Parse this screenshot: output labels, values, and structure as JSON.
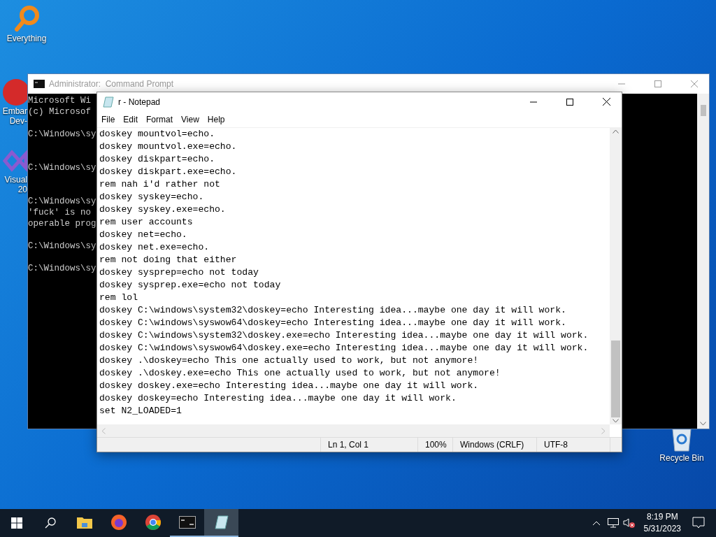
{
  "desktop_icons": [
    {
      "kind": "magnifier",
      "lines": [
        "Everything"
      ]
    },
    {
      "kind": "badge",
      "lines": [
        "Embar",
        "Dev-"
      ]
    },
    {
      "kind": "ribbon",
      "lines": [
        "Visual",
        "20"
      ]
    }
  ],
  "cmd": {
    "title": "Administrator:  Command Prompt",
    "blocks": [
      {
        "lines": [
          "Microsoft Wi",
          "(c) Microsof"
        ]
      },
      {
        "lines": [
          "C:\\Windows\\sy"
        ]
      },
      {
        "lines": [
          "C:\\Windows\\sy"
        ]
      },
      {
        "lines": [
          "C:\\Windows\\sy",
          "'fuck' is no",
          "operable prog"
        ]
      },
      {
        "lines": [
          "C:\\Windows\\sy"
        ]
      },
      {
        "lines": [
          "C:\\Windows\\sy"
        ]
      }
    ]
  },
  "notepad": {
    "title": "r - Notepad",
    "menu": [
      "File",
      "Edit",
      "Format",
      "View",
      "Help"
    ],
    "lines": [
      "doskey mountvol=echo.",
      "doskey mountvol.exe=echo.",
      "doskey diskpart=echo.",
      "doskey diskpart.exe=echo.",
      "rem nah i'd rather not",
      "doskey syskey=echo.",
      "doskey syskey.exe=echo.",
      "rem user accounts",
      "doskey net=echo.",
      "doskey net.exe=echo.",
      "rem not doing that either",
      "doskey sysprep=echo not today",
      "doskey sysprep.exe=echo not today",
      "rem lol",
      "doskey C:\\windows\\system32\\doskey=echo Interesting idea...maybe one day it will work.",
      "doskey C:\\windows\\syswow64\\doskey=echo Interesting idea...maybe one day it will work.",
      "doskey C:\\windows\\system32\\doskey.exe=echo Interesting idea...maybe one day it will work.",
      "doskey C:\\windows\\syswow64\\doskey.exe=echo Interesting idea...maybe one day it will work.",
      "doskey .\\doskey=echo This one actually used to work, but not anymore!",
      "doskey .\\doskey.exe=echo This one actually used to work, but not anymore!",
      "doskey doskey.exe=echo Interesting idea...maybe one day it will work.",
      "doskey doskey=echo Interesting idea...maybe one day it will work.",
      "set N2_LOADED=1"
    ],
    "status": [
      "Ln 1, Col 1",
      "100%",
      "Windows (CRLF)",
      "UTF-8"
    ]
  },
  "recycle_bin": {
    "label": "Recycle Bin"
  },
  "taskbar": {
    "apps": [
      {
        "kind": "folder",
        "selected": false,
        "running": false
      },
      {
        "kind": "firefox",
        "selected": false,
        "running": false
      },
      {
        "kind": "chrome",
        "selected": false,
        "running": false
      },
      {
        "kind": "terminal",
        "selected": false,
        "running": true
      },
      {
        "kind": "notepad",
        "selected": true,
        "running": true
      }
    ],
    "time": "8:19 PM",
    "date": "5/31/2023"
  }
}
